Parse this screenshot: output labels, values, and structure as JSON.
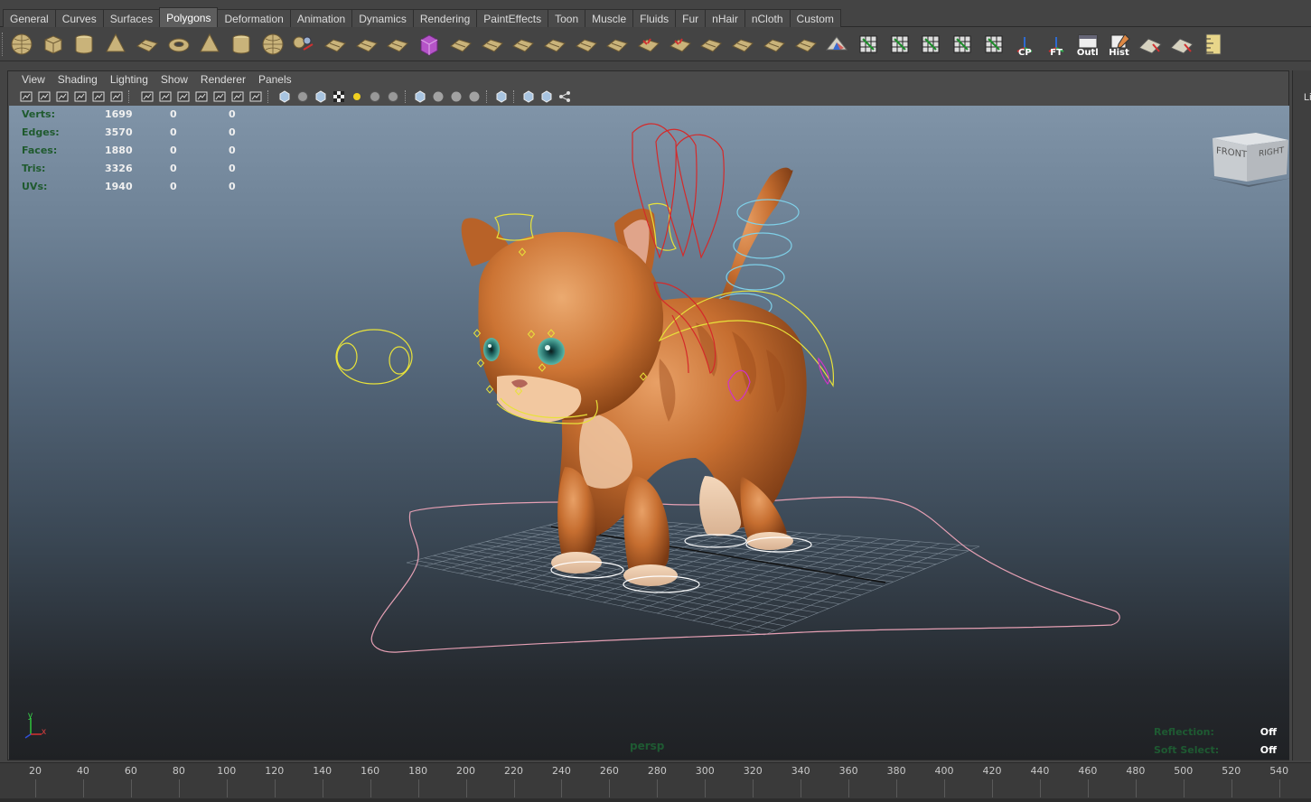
{
  "shelf_tabs": [
    {
      "label": "General",
      "active": false
    },
    {
      "label": "Curves",
      "active": false
    },
    {
      "label": "Surfaces",
      "active": false
    },
    {
      "label": "Polygons",
      "active": true
    },
    {
      "label": "Deformation",
      "active": false
    },
    {
      "label": "Animation",
      "active": false
    },
    {
      "label": "Dynamics",
      "active": false
    },
    {
      "label": "Rendering",
      "active": false
    },
    {
      "label": "PaintEffects",
      "active": false
    },
    {
      "label": "Toon",
      "active": false
    },
    {
      "label": "Muscle",
      "active": false
    },
    {
      "label": "Fluids",
      "active": false
    },
    {
      "label": "Fur",
      "active": false
    },
    {
      "label": "nHair",
      "active": false
    },
    {
      "label": "nCloth",
      "active": false
    },
    {
      "label": "Custom",
      "active": false
    }
  ],
  "shelf_icons": [
    {
      "name": "poly-sphere-icon",
      "label": ""
    },
    {
      "name": "poly-cube-icon",
      "label": ""
    },
    {
      "name": "poly-cylinder-icon",
      "label": ""
    },
    {
      "name": "poly-cone-icon",
      "label": ""
    },
    {
      "name": "poly-plane-icon",
      "label": ""
    },
    {
      "name": "poly-torus-icon",
      "label": ""
    },
    {
      "name": "poly-pyramid-icon",
      "label": ""
    },
    {
      "name": "poly-pipe-icon",
      "label": ""
    },
    {
      "name": "poly-soccer-ball-icon",
      "label": ""
    },
    {
      "name": "combine-icon",
      "label": ""
    },
    {
      "name": "separate-icon",
      "label": ""
    },
    {
      "name": "smooth-icon",
      "label": ""
    },
    {
      "name": "mirror-cut-icon",
      "label": ""
    },
    {
      "name": "make-live-icon",
      "label": ""
    },
    {
      "name": "append-polygon-icon",
      "label": ""
    },
    {
      "name": "split-polygon-icon",
      "label": ""
    },
    {
      "name": "insert-edge-loop-icon",
      "label": ""
    },
    {
      "name": "offset-edge-loop-icon",
      "label": ""
    },
    {
      "name": "extrude-icon",
      "label": ""
    },
    {
      "name": "bridge-icon",
      "label": ""
    },
    {
      "name": "merge-icon",
      "label": ""
    },
    {
      "name": "collapse-icon",
      "label": ""
    },
    {
      "name": "bevel-icon",
      "label": ""
    },
    {
      "name": "chamfer-icon",
      "label": ""
    },
    {
      "name": "poke-icon",
      "label": ""
    },
    {
      "name": "wedge-icon",
      "label": ""
    },
    {
      "name": "sculpt-icon",
      "label": ""
    },
    {
      "name": "planar-map-icon",
      "label": ""
    },
    {
      "name": "cylindrical-map-icon",
      "label": ""
    },
    {
      "name": "spherical-map-icon",
      "label": ""
    },
    {
      "name": "automatic-map-icon",
      "label": ""
    },
    {
      "name": "uv-editor-icon",
      "label": ""
    },
    {
      "name": "cp-icon",
      "label": "CP"
    },
    {
      "name": "ft-icon",
      "label": "FT"
    },
    {
      "name": "outliner-icon",
      "label": "Outl"
    },
    {
      "name": "history-icon",
      "label": "Hist"
    },
    {
      "name": "transfer-attributes-icon",
      "label": ""
    },
    {
      "name": "select-faces-icon",
      "label": ""
    },
    {
      "name": "measure-icon",
      "label": ""
    }
  ],
  "panel_menu": [
    "View",
    "Shading",
    "Lighting",
    "Show",
    "Renderer",
    "Panels"
  ],
  "hud_stats": [
    {
      "label": "Verts:",
      "v1": "1699",
      "v2": "0",
      "v3": "0"
    },
    {
      "label": "Edges:",
      "v1": "3570",
      "v2": "0",
      "v3": "0"
    },
    {
      "label": "Faces:",
      "v1": "1880",
      "v2": "0",
      "v3": "0"
    },
    {
      "label": "Tris:",
      "v1": "3326",
      "v2": "0",
      "v3": "0"
    },
    {
      "label": "UVs:",
      "v1": "1940",
      "v2": "0",
      "v3": "0"
    }
  ],
  "viewcube": {
    "front": "FRONT",
    "right": "RIGHT"
  },
  "camera_name": "persp",
  "hud_right": [
    {
      "label": "Reflection:",
      "value": "Off"
    },
    {
      "label": "Soft Select:",
      "value": "Off"
    }
  ],
  "axis": {
    "x": "x",
    "y": "y"
  },
  "right_gutter_label": "Li",
  "timeline_ticks": [
    "20",
    "40",
    "60",
    "80",
    "100",
    "120",
    "140",
    "160",
    "180",
    "200",
    "220",
    "240",
    "260",
    "280",
    "300",
    "320",
    "340",
    "360",
    "380",
    "400",
    "420",
    "440",
    "460",
    "480",
    "500",
    "520",
    "540"
  ],
  "colors": {
    "hud_label": "#1f5a2e",
    "control_yellow": "#e8e23a",
    "control_red": "#d42a2a",
    "control_cyan": "#7fd0e8",
    "control_magenta": "#d033c8",
    "control_pink": "#e6a0b4",
    "cat_fur": "#d07a3a"
  }
}
